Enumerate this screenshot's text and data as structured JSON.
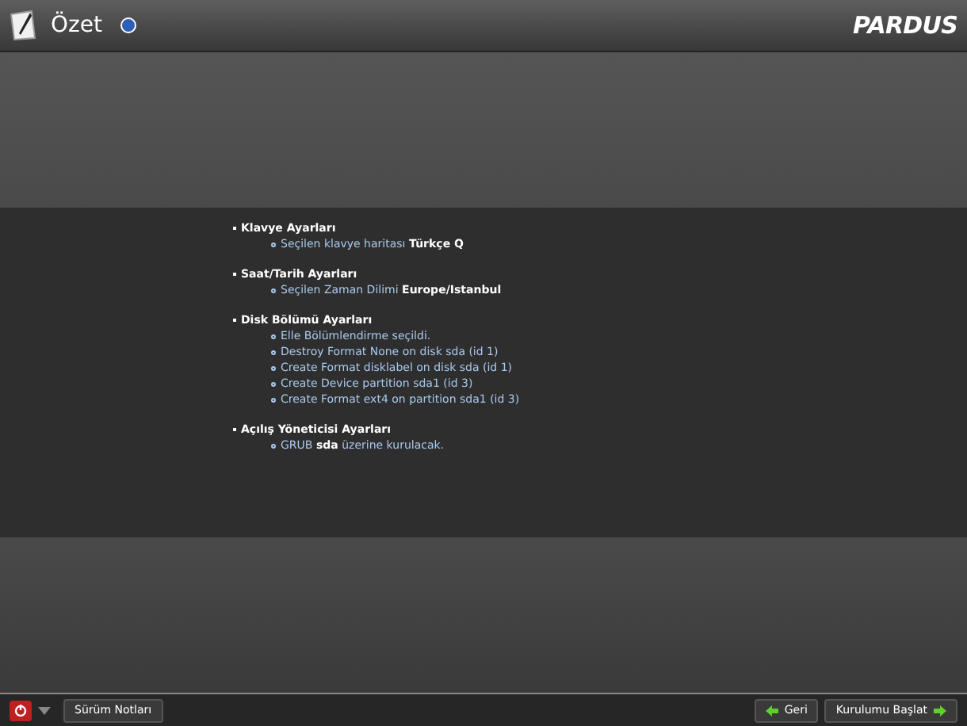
{
  "header": {
    "title": "Özet",
    "logo": "PARDUS"
  },
  "sections": [
    {
      "title": "Klavye Ayarları",
      "items": [
        "Seçilen klavye haritası **Türkçe Q**"
      ]
    },
    {
      "title": "Saat/Tarih Ayarları",
      "items": [
        "Seçilen Zaman Dilimi **Europe/Istanbul**"
      ]
    },
    {
      "title": "Disk Bölümü Ayarları",
      "items": [
        "Elle Bölümlendirme seçildi.",
        "Destroy Format None on disk sda (id 1)",
        "Create Format disklabel on disk sda (id 1)",
        "Create Device partition sda1 (id 3)",
        "Create Format ext4 on partition sda1 (id 3)"
      ]
    },
    {
      "title": "Açılış Yöneticisi Ayarları",
      "items": [
        "GRUB **sda** üzerine kurulacak."
      ]
    }
  ],
  "footer": {
    "release_notes": "Sürüm Notları",
    "back": "Geri",
    "start": "Kurulumu Başlat"
  }
}
